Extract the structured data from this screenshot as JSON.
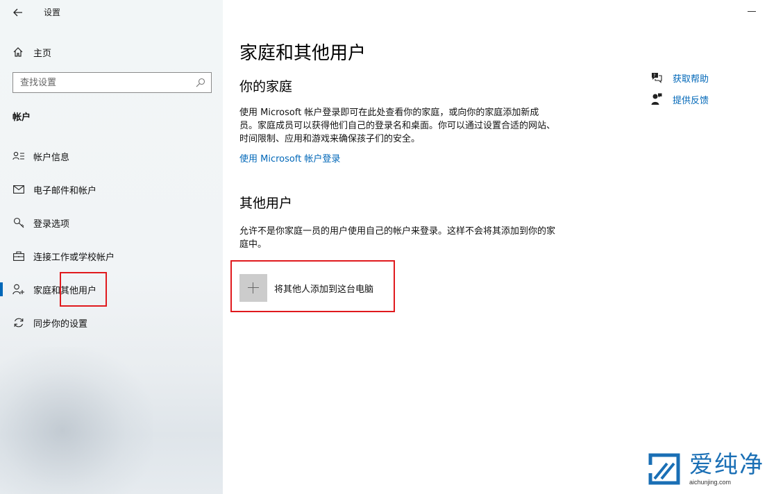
{
  "window": {
    "app_title": "设置"
  },
  "sidebar": {
    "home_label": "主页",
    "search_placeholder": "查找设置",
    "section_title": "帐户",
    "items": [
      {
        "label": "帐户信息",
        "icon": "account-info-icon"
      },
      {
        "label": "电子邮件和帐户",
        "icon": "mail-icon"
      },
      {
        "label": "登录选项",
        "icon": "key-icon"
      },
      {
        "label": "连接工作或学校帐户",
        "icon": "briefcase-icon"
      },
      {
        "label": "家庭和其他用户",
        "icon": "person-add-icon",
        "active": true
      },
      {
        "label": "同步你的设置",
        "icon": "sync-icon"
      }
    ]
  },
  "main": {
    "title": "家庭和其他用户",
    "family": {
      "heading": "你的家庭",
      "description": "使用 Microsoft 帐户登录即可在此处查看你的家庭，或向你的家庭添加新成员。家庭成员可以获得他们自己的登录名和桌面。你可以通过设置合适的网站、时间限制、应用和游戏来确保孩子们的安全。",
      "link": "使用 Microsoft 帐户登录"
    },
    "others": {
      "heading": "其他用户",
      "description": "允许不是你家庭一员的用户使用自己的帐户来登录。这样不会将其添加到你的家庭中。",
      "add_button_label": "将其他人添加到这台电脑"
    },
    "help": {
      "get_help": "获取帮助",
      "feedback": "提供反馈"
    }
  },
  "watermark": {
    "text": "爱纯净",
    "url": "aichunjing.com"
  },
  "colors": {
    "accent": "#0067b8",
    "highlight_box": "#e0191d"
  }
}
